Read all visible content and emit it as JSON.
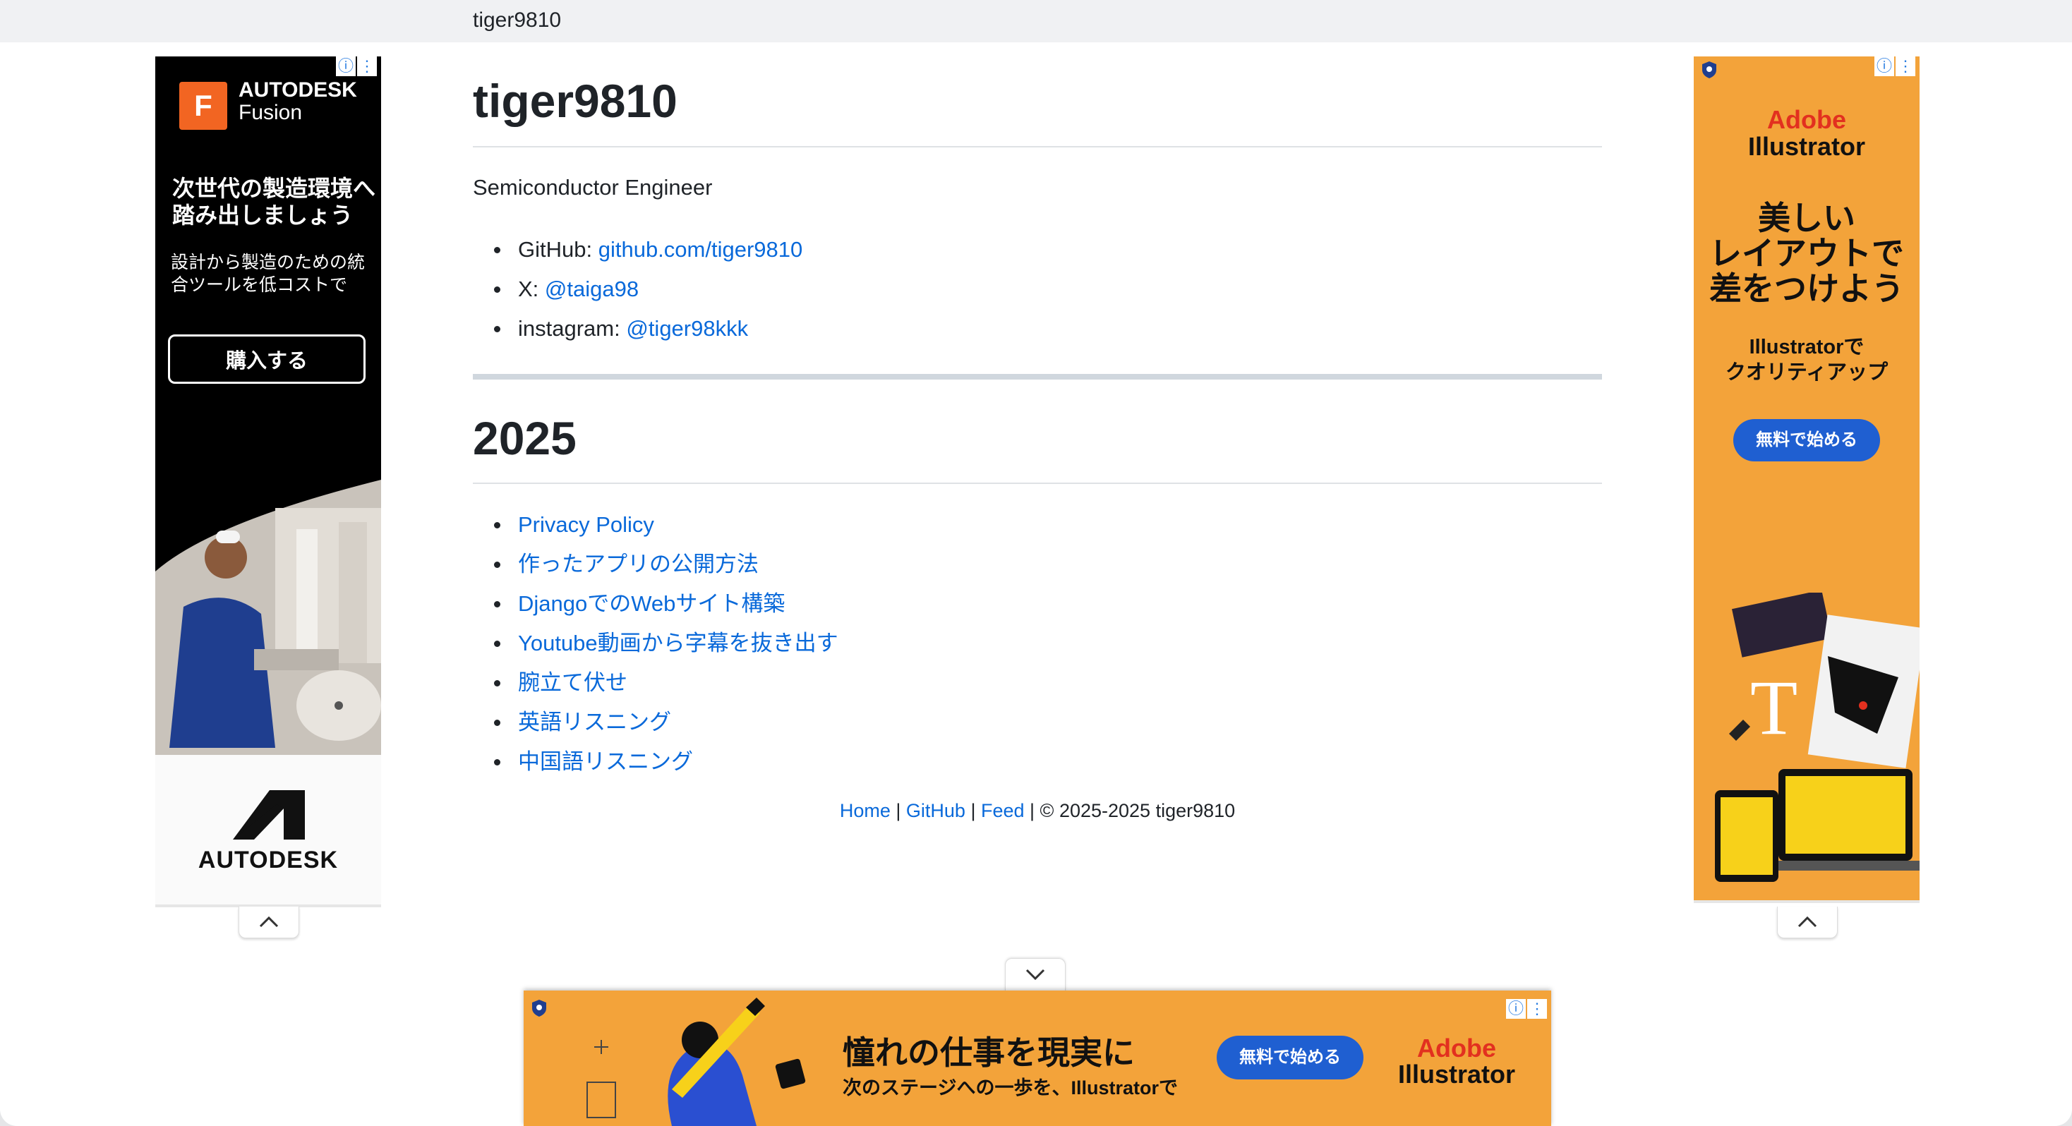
{
  "browser": {
    "tab_title": "tiger9810"
  },
  "page": {
    "title": "tiger9810",
    "description": "Semiconductor Engineer",
    "links": [
      {
        "prefix": "GitHub: ",
        "text": "github.com/tiger9810"
      },
      {
        "prefix": "X: ",
        "text": "@taiga98"
      },
      {
        "prefix": "instagram: ",
        "text": "@tiger98kkk"
      }
    ],
    "year_heading": "2025",
    "posts": [
      "Privacy Policy",
      "作ったアプリの公開方法",
      "DjangoでのWebサイト構築",
      "Youtube動画から字幕を抜き出す",
      "腕立て伏せ",
      "英語リスニング",
      "中国語リスニング"
    ],
    "footer": {
      "home": "Home",
      "sep": " | ",
      "github": "GitHub",
      "feed": "Feed",
      "copyright": " | © 2025-2025 tiger9810"
    }
  },
  "ads": {
    "left": {
      "brand_letter": "F",
      "brand_line1": "AUTODESK",
      "brand_line2": "Fusion",
      "headline": "次世代の製造環境へ踏み出しましょう",
      "sub": "設計から製造のための統合ツールを低コストで",
      "button": "購入する",
      "logo_text": "AUTODESK"
    },
    "right": {
      "brand_line1": "Adobe",
      "brand_line2": "Illustrator",
      "headline_lines": [
        "美しい",
        "レイアウトで",
        "差をつけよう"
      ],
      "sub_lines": [
        "Illustratorで",
        "クオリティアップ"
      ],
      "button": "無料で始める"
    },
    "bottom": {
      "headline": "憧れの仕事を現実に",
      "sub": "次のステージへの一歩を、Illustratorで",
      "button": "無料で始める",
      "brand_line1": "Adobe",
      "brand_line2": "Illustrator"
    },
    "icons": {
      "info": "ⓘ",
      "menu": "⋮"
    }
  }
}
